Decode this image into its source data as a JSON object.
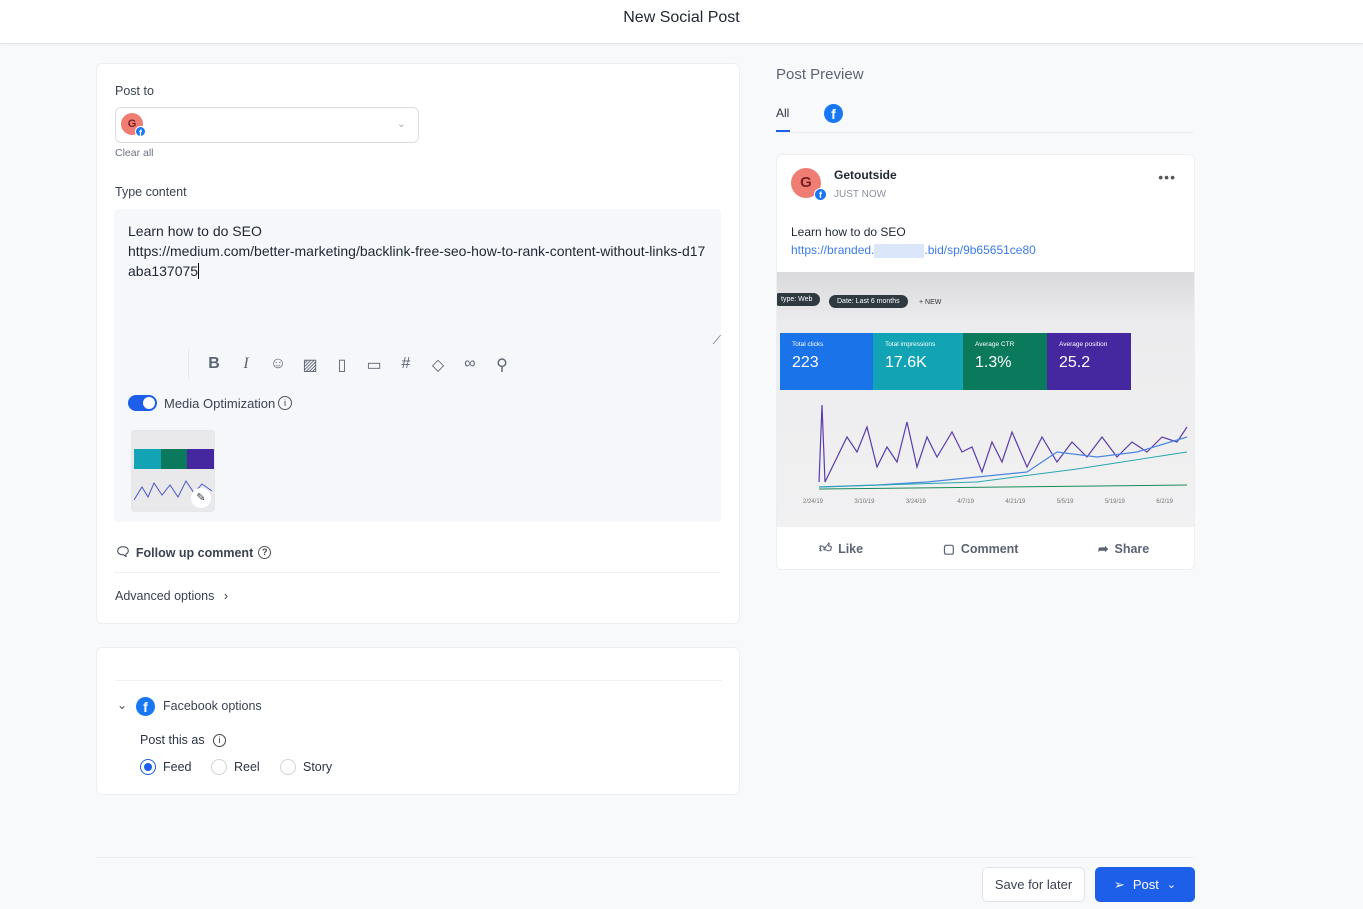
{
  "header": {
    "title": "New Social Post"
  },
  "composer": {
    "post_to_label": "Post to",
    "account_initial": "G",
    "clear_all": "Clear all",
    "type_content_label": "Type content",
    "content_line1": "Learn how to do SEO",
    "content_line2": "https://medium.com/better-marketing/backlink-free-seo-how-to-rank-content-without-links-d17aba137075",
    "toolbar": [
      "bold-icon",
      "italic-icon",
      "emoji-icon",
      "image-icon",
      "file-icon",
      "video-icon",
      "hashtag-icon",
      "tag-icon",
      "link-icon",
      "location-icon"
    ],
    "media_optimization": "Media Optimization",
    "media_optimization_on": true,
    "follow_up_comment": "Follow up comment",
    "advanced_options": "Advanced options"
  },
  "facebook_options": {
    "title": "Facebook options",
    "post_this_as": "Post this as",
    "options": [
      "Feed",
      "Reel",
      "Story"
    ],
    "selected": "Feed"
  },
  "preview": {
    "title": "Post Preview",
    "tabs": [
      "All",
      "facebook-icon"
    ],
    "active_tab": "All",
    "account_name": "Getoutside",
    "time": "JUST NOW",
    "text": "Learn how to do SEO",
    "link_prefix": "https://branded.",
    "link_suffix": ".bid/sp/9b65651ce80",
    "image": {
      "chips": [
        "type: Web",
        "Date: Last 6 months",
        "+ NEW"
      ],
      "metrics": [
        {
          "label": "Total clicks",
          "value": "223",
          "color": "#1a73e8"
        },
        {
          "label": "Total impressions",
          "value": "17.6K",
          "color": "#12a4b4"
        },
        {
          "label": "Average CTR",
          "value": "1.3%",
          "color": "#0b7a5c"
        },
        {
          "label": "Average position",
          "value": "25.2",
          "color": "#4527a0"
        }
      ],
      "dates": [
        "2/24/19",
        "3/10/19",
        "3/24/19",
        "4/7/19",
        "4/21/19",
        "5/5/19",
        "5/19/19",
        "6/2/19"
      ]
    },
    "actions": [
      "Like",
      "Comment",
      "Share"
    ]
  },
  "footer": {
    "save_for_later": "Save for later",
    "post": "Post"
  },
  "colors": {
    "accent": "#1d5fe8",
    "facebook": "#1877f2",
    "avatar": "#ef7d74"
  }
}
